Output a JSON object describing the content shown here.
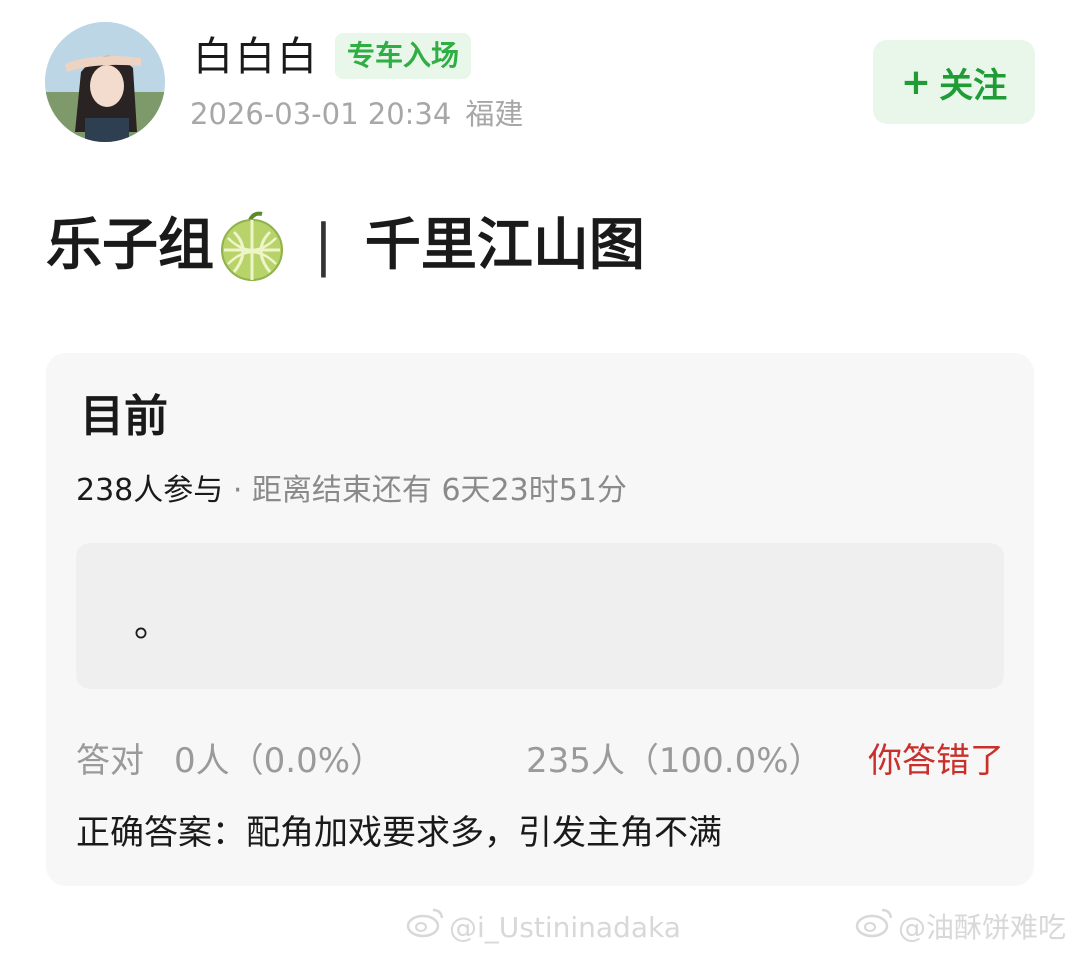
{
  "header": {
    "username": "白白白",
    "tag": "专车入场",
    "timestamp": "2026-03-01 20:34",
    "location": "福建",
    "follow_plus": "+",
    "follow_label": "关注"
  },
  "post": {
    "title_left": "乐子组",
    "title_separator": "|",
    "title_right": "千里江山图",
    "title_icon": "melon-emoji"
  },
  "quiz": {
    "heading": "目前",
    "participants": "238人参与",
    "dot": "·",
    "remaining": "距离结束还有 6天23时51分",
    "option_text": "。",
    "correct_label": "答对",
    "correct_value": "0人（0.0%）",
    "wrong_value": "235人（100.0%）",
    "verdict": "你答错了",
    "answer": "正确答案：配角加戏要求多，引发主角不满"
  },
  "watermarks": {
    "left": "@i_Ustininadaka",
    "right": "@油酥饼难吃",
    "icon": "weibo-icon"
  },
  "colors": {
    "accent_green": "#2fae43",
    "tag_bg": "#e8f7ea",
    "wrong_red": "#c9302c",
    "card_bg": "#f7f7f7"
  }
}
